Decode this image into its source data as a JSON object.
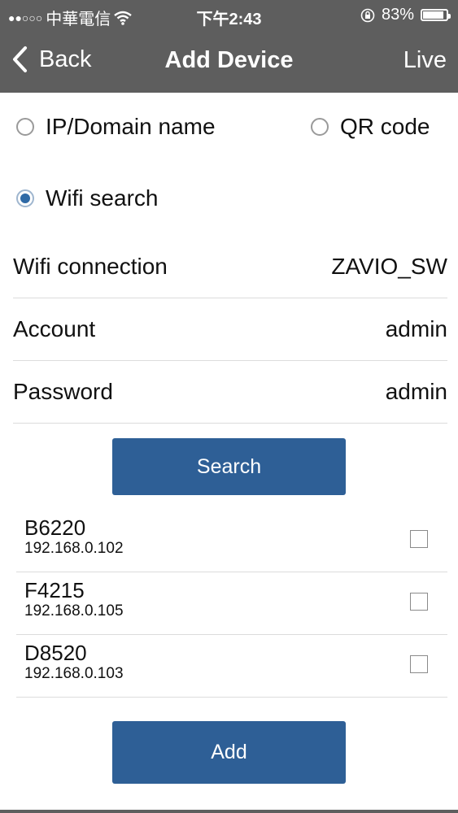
{
  "status_bar": {
    "signal": "●●○○○",
    "carrier": "中華電信",
    "time": "下午2:43",
    "battery_percent": "83%",
    "battery_level": 0.83
  },
  "nav": {
    "back_label": "Back",
    "title": "Add Device",
    "live_label": "Live"
  },
  "mode_options": [
    {
      "label": "IP/Domain name",
      "selected": false
    },
    {
      "label": "QR code",
      "selected": false
    },
    {
      "label": "Wifi search",
      "selected": true
    }
  ],
  "fields": {
    "wifi_connection": {
      "label": "Wifi connection",
      "value": "ZAVIO_SW"
    },
    "account": {
      "label": "Account",
      "value": "admin"
    },
    "password": {
      "label": "Password",
      "value": "admin"
    }
  },
  "search_button": "Search",
  "devices": [
    {
      "name": "B6220",
      "ip": "192.168.0.102",
      "checked": false
    },
    {
      "name": "F4215",
      "ip": "192.168.0.105",
      "checked": false
    },
    {
      "name": "D8520",
      "ip": "192.168.0.103",
      "checked": false
    }
  ],
  "add_button": "Add",
  "colors": {
    "bar_background": "#5e5e5e",
    "button_blue": "#2e5f96",
    "radio_selected": "#2f6aa6"
  }
}
